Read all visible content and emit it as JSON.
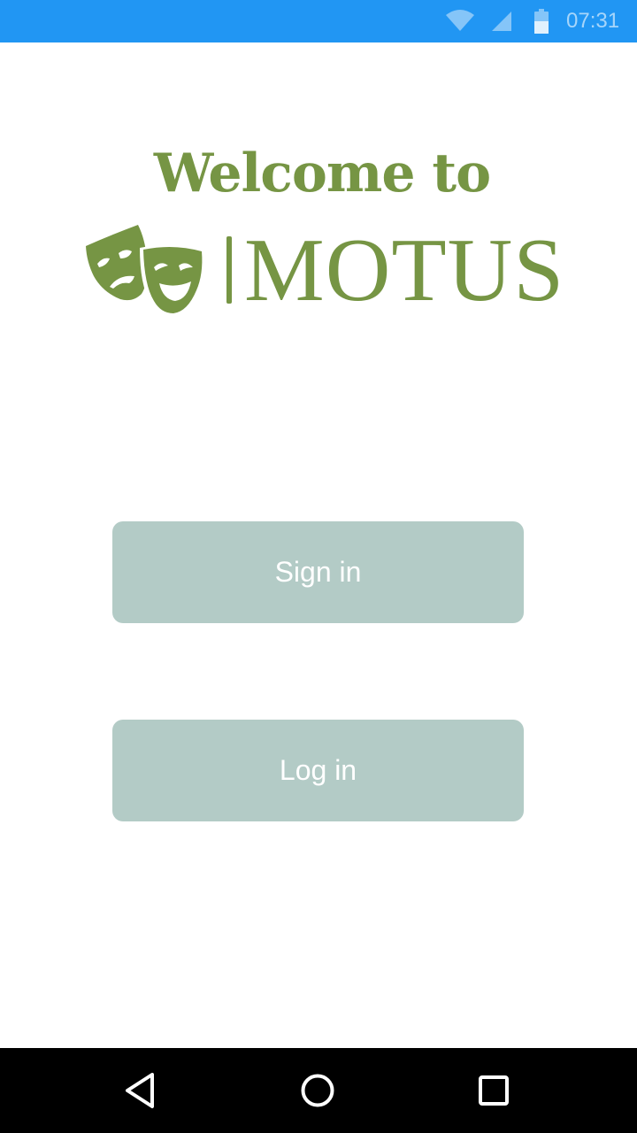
{
  "status_bar": {
    "time": "07:31",
    "icons": [
      "wifi-icon",
      "cell-signal-icon",
      "battery-icon"
    ],
    "background": "#2196f3"
  },
  "welcome": {
    "title": "Welcome to"
  },
  "logo": {
    "wordmark": "MOTUS",
    "icon": "theater-masks-icon",
    "color": "#769544"
  },
  "buttons": {
    "sign_in": "Sign in",
    "log_in": "Log in",
    "color": "#b3cbc6"
  },
  "nav_bar": {
    "icons": [
      "back-icon",
      "home-icon",
      "recents-icon"
    ]
  }
}
